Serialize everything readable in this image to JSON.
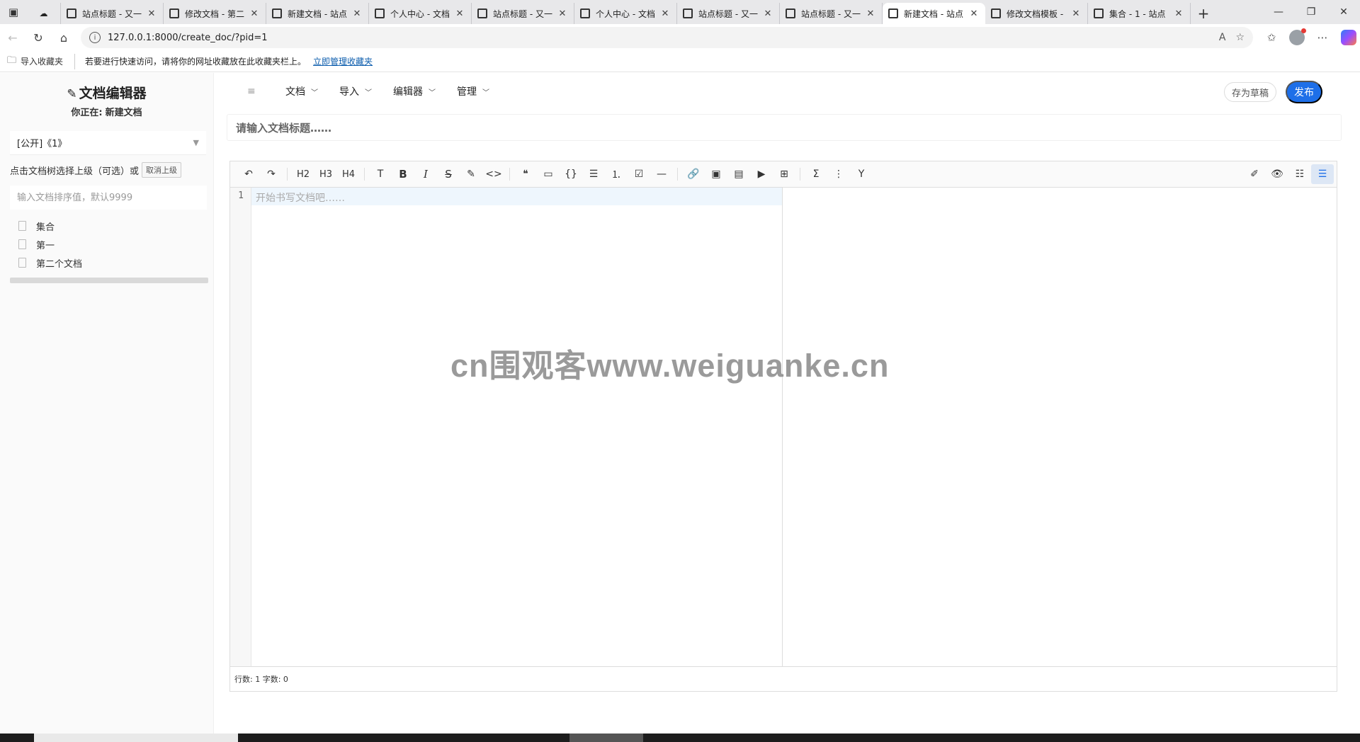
{
  "browser": {
    "tabs": [
      {
        "title": "",
        "active": false
      },
      {
        "title": "站点标题 - 又一",
        "active": false
      },
      {
        "title": "修改文档 - 第二",
        "active": false
      },
      {
        "title": "新建文档 - 站点",
        "active": false
      },
      {
        "title": "个人中心 - 文档",
        "active": false
      },
      {
        "title": "站点标题 - 又一",
        "active": false
      },
      {
        "title": "个人中心 - 文档",
        "active": false
      },
      {
        "title": "站点标题 - 又一",
        "active": false
      },
      {
        "title": "站点标题 - 又一",
        "active": false
      },
      {
        "title": "新建文档 - 站点",
        "active": true
      },
      {
        "title": "修改文档模板 -",
        "active": false
      },
      {
        "title": "集合 - 1 - 站点",
        "active": false
      }
    ],
    "url": "127.0.0.1:8000/create_doc/?pid=1",
    "favorites": {
      "import_label": "导入收藏夹",
      "tip": "若要进行快速访问，请将你的网址收藏放在此收藏夹栏上。",
      "manage_link": "立即管理收藏夹"
    }
  },
  "sidebar": {
    "title": "文档编辑器",
    "location_label": "你正在:",
    "location_value": "新建文档",
    "project_select": "[公开]《1》",
    "parent_hint": "点击文档树选择上级（可选）或",
    "cancel_parent": "取消上级",
    "order_placeholder": "输入文档排序值，默认9999",
    "tree": [
      {
        "label": "集合"
      },
      {
        "label": "第一"
      },
      {
        "label": "第二个文档"
      }
    ]
  },
  "topnav": {
    "items": [
      {
        "label": "文档"
      },
      {
        "label": "导入"
      },
      {
        "label": "编辑器"
      },
      {
        "label": "管理"
      }
    ],
    "draft_button": "存为草稿",
    "publish_button": "发布"
  },
  "editor": {
    "title_placeholder": "请输入文档标题……",
    "toolbar": {
      "h2": "H2",
      "h3": "H3",
      "h4": "H4",
      "text": "T",
      "bold": "B",
      "italic": "I",
      "strike": "S"
    },
    "line_number": "1",
    "body_placeholder": "开始书写文档吧……",
    "status": "行数: 1 字数: 0"
  },
  "watermark": "cn围观客www.weiguanke.cn",
  "colors": {
    "accent": "#1e6fe8",
    "active_line": "#eef6fd"
  }
}
